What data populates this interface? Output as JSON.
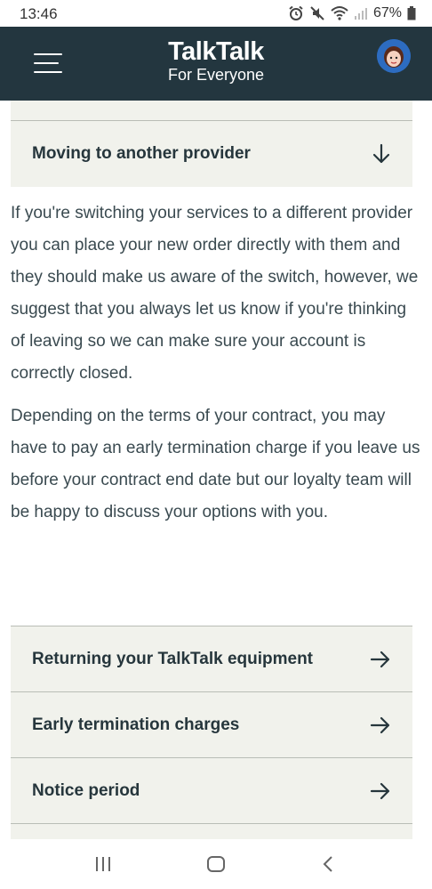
{
  "status_bar": {
    "time": "13:46",
    "battery": "67%",
    "icons": [
      "alarm-icon",
      "mute-icon",
      "wifi-icon",
      "signal-icon",
      "battery-icon"
    ]
  },
  "header": {
    "brand": "TalkTalk",
    "tagline": "For Everyone",
    "menu_icon": "hamburger-menu-icon",
    "avatar_icon": "avatar"
  },
  "accordion": {
    "title": "Moving to another provider",
    "icon": "arrow-down-icon"
  },
  "content": {
    "paragraph_1": "If you're switching your services to a different provider you can place your new order directly with them and they should make us aware of the switch, however, we suggest that you always let us know if you're thinking of leaving so we can make sure your account is correctly closed.",
    "paragraph_2": "Depending on the terms of your contract, you may have to pay an early termination charge if you leave us before your contract end date but our loyalty team will be happy to discuss your options with you."
  },
  "links": [
    {
      "label": "Returning your TalkTalk equipment",
      "icon": "arrow-right-icon"
    },
    {
      "label": "Early termination charges",
      "icon": "arrow-right-icon"
    },
    {
      "label": "Notice period",
      "icon": "arrow-right-icon"
    }
  ],
  "colors": {
    "header_bg": "#23363f",
    "panel_bg": "#f1f2ec",
    "text": "#3a4a50"
  },
  "nav_bar": {
    "icons": [
      "recent-apps-icon",
      "home-icon",
      "back-icon"
    ]
  }
}
